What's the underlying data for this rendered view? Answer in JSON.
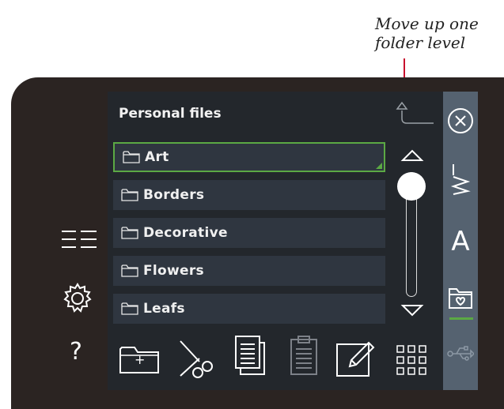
{
  "annotation": {
    "line1": "Move up one",
    "line2": "folder level"
  },
  "left_sidebar": {
    "icons": [
      "list-view-icon",
      "settings-gear-icon",
      "help-icon"
    ],
    "help_label": "?"
  },
  "header": {
    "title": "Personal files"
  },
  "file_list": {
    "items": [
      {
        "label": "Art",
        "selected": true
      },
      {
        "label": "Borders",
        "selected": false
      },
      {
        "label": "Decorative",
        "selected": false
      },
      {
        "label": "Flowers",
        "selected": false
      },
      {
        "label": "Leafs",
        "selected": false
      }
    ],
    "scroll_position": 0
  },
  "toolbar": {
    "icons": [
      "new-folder-icon",
      "cut-icon",
      "copy-icon",
      "paste-icon",
      "rename-icon",
      "grid-view-icon"
    ],
    "new_folder_symbol": "+"
  },
  "right_panel": {
    "icons": [
      "close-icon",
      "stitch-menu-icon",
      "font-icon",
      "personal-files-icon",
      "usb-icon"
    ],
    "font_label": "A",
    "active": "personal-files-icon"
  },
  "colors": {
    "device": "#2b2422",
    "screen": "#23272c",
    "row": "#2f3640",
    "right_panel": "#556270",
    "accent_green": "#5ba944",
    "callout": "#c8102e"
  }
}
